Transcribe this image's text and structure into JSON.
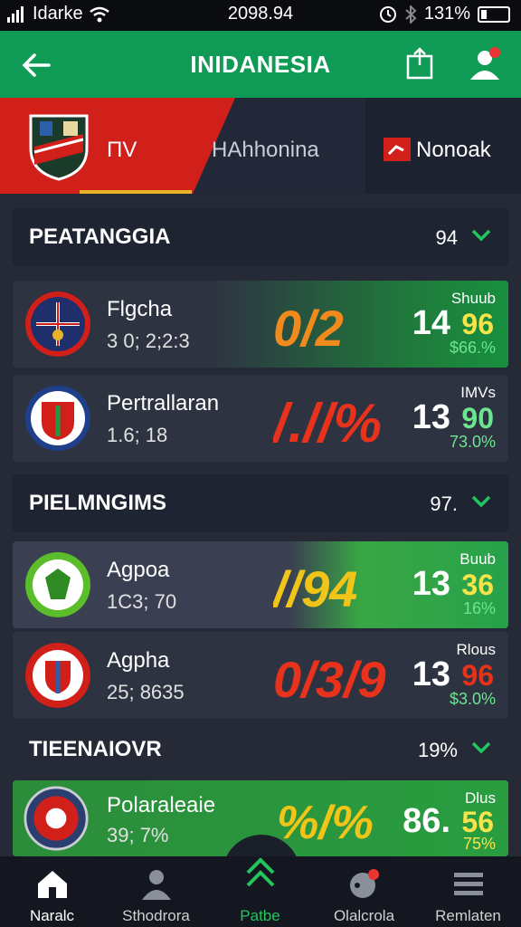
{
  "status_bar": {
    "carrier": "Idarke",
    "time": "2098.94",
    "battery": "131%"
  },
  "app_bar": {
    "title": "INIDANESIA"
  },
  "tabs": [
    {
      "label": "ΠV"
    },
    {
      "label": "HAhhonina"
    },
    {
      "label": "Nonoak"
    }
  ],
  "sections": [
    {
      "title": "PEATANGGIA",
      "count": "94",
      "rows": [
        {
          "name": "Flgcha",
          "sub": "3 0; 2;2:3",
          "odds": "0/2",
          "big": "14",
          "big_accent": "96",
          "small_top": "Shuub",
          "small_bottom": "$66.%"
        },
        {
          "name": "Pertrallaran",
          "sub": "1.6; 18",
          "odds": "/.//%",
          "big": "13",
          "big_accent": "90",
          "small_top": "IMVs",
          "small_bottom": "73.0%"
        }
      ]
    },
    {
      "title": "PIELMNGIMS",
      "count": "97.",
      "rows": [
        {
          "name": "Agpoa",
          "sub": "1C3; 70",
          "odds": "//94",
          "big": "13",
          "big_accent": "36",
          "small_top": "Buub",
          "small_bottom": "16%"
        },
        {
          "name": "Agpha",
          "sub": "25; 8635",
          "odds": "0/3/9",
          "big": "13",
          "big_accent": "96",
          "small_top": "Rlous",
          "small_bottom": "$3.0%"
        }
      ]
    },
    {
      "title": "TIEENAIOVR",
      "count": "19%",
      "rows": [
        {
          "name": "Polaraleaie",
          "sub": "39; 7%",
          "odds": "%/%",
          "big": "86.",
          "big_accent": "56",
          "small_top": "Dlus",
          "small_bottom": "75%"
        }
      ]
    }
  ],
  "bottom_nav": [
    {
      "label": "Naralc",
      "icon": "home-icon"
    },
    {
      "label": "Sthodrora",
      "icon": "person-icon"
    },
    {
      "label": "Patbe",
      "icon": "double-chevron-up-icon"
    },
    {
      "label": "Olalcrola",
      "icon": "notification-icon"
    },
    {
      "label": "Remlaten",
      "icon": "menu-icon"
    }
  ],
  "colors": {
    "brand_green": "#0f9a55",
    "accent_red": "#d11f1a",
    "accent_yellow": "#e8b32a"
  }
}
